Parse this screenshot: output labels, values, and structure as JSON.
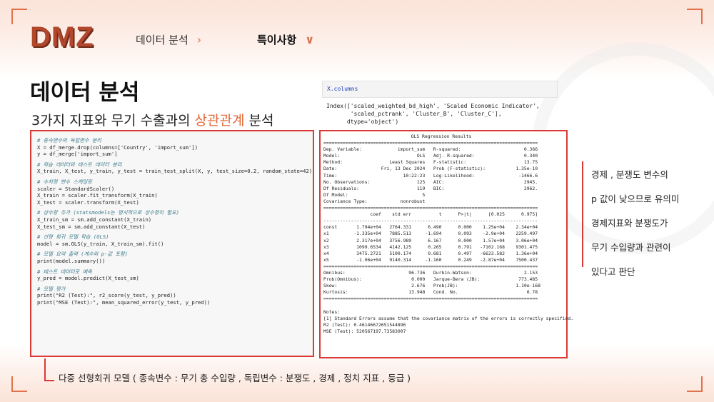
{
  "logo": "DMZ",
  "nav": {
    "item1": "데이터 분석",
    "item1_chevron": "›",
    "item2": "특이사항",
    "item2_chevron": "∨"
  },
  "page_title": "데이터 분석",
  "subtitle": {
    "prefix": "3가지 지표와 무기 수출과의 ",
    "accent": "상관관계",
    "suffix": " 분석"
  },
  "code": [
    {
      "t": "cm",
      "s": "# 종속변수와 독립변수 분리"
    },
    {
      "t": "code",
      "s": "X = df_merge.drop(columns=['Country', 'import_sum'])"
    },
    {
      "t": "code",
      "s": "y = df_merge['import_sum']"
    },
    {
      "t": "gap",
      "s": ""
    },
    {
      "t": "cm",
      "s": "# 학습 데이터와 테스트 데이터 분리"
    },
    {
      "t": "code",
      "s": "X_train, X_test, y_train, y_test = train_test_split(X, y, test_size=0.2, random_state=42)"
    },
    {
      "t": "gap",
      "s": ""
    },
    {
      "t": "cm",
      "s": "# 수치형 변수 스케일링"
    },
    {
      "t": "code",
      "s": "scaler = StandardScaler()"
    },
    {
      "t": "code",
      "s": "X_train = scaler.fit_transform(X_train)"
    },
    {
      "t": "code",
      "s": "X_test = scaler.transform(X_test)"
    },
    {
      "t": "gap",
      "s": ""
    },
    {
      "t": "cm",
      "s": "# 상수항 추가 (statsmodels는 명시적으로 상수항이 필요)"
    },
    {
      "t": "code",
      "s": "X_train_sm = sm.add_constant(X_train)"
    },
    {
      "t": "code",
      "s": "X_test_sm = sm.add_constant(X_test)"
    },
    {
      "t": "gap",
      "s": ""
    },
    {
      "t": "cm",
      "s": "# 선형 회귀 모델 학습 (OLS)"
    },
    {
      "t": "code",
      "s": "model = sm.OLS(y_train, X_train_sm).fit()"
    },
    {
      "t": "gap",
      "s": ""
    },
    {
      "t": "cm",
      "s": "# 모델 요약 출력 (계수와 p-값 포함)"
    },
    {
      "t": "code",
      "s": "print(model.summary())"
    },
    {
      "t": "gap",
      "s": ""
    },
    {
      "t": "cm",
      "s": "# 테스트 데이터로 예측"
    },
    {
      "t": "code",
      "s": "y_pred = model.predict(X_test_sm)"
    },
    {
      "t": "gap",
      "s": ""
    },
    {
      "t": "cm",
      "s": "# 모델 평가"
    },
    {
      "t": "code",
      "s": "print(\"R2 (Test):\", r2_score(y_test, y_pred))"
    },
    {
      "t": "code",
      "s": "print(\"MSE (Test):\", mean_squared_error(y_test, y_pred))"
    }
  ],
  "xcolumns_cell": "X.columns",
  "index_output": [
    "Index(['scaled_weighted_bd_high', 'Scaled Economic Indicator',",
    "       'scaled_pctrank', 'Cluster_B', 'Cluster_C'],",
    "      dtype='object')"
  ],
  "ols": {
    "title": "OLS Regression Results",
    "lines": [
      "==============================================================================",
      "Dep. Variable:             import_sum   R-squared:                       0.366",
      "Model:                            OLS   Adj. R-squared:                  0.340",
      "Method:                 Least Squares   F-statistic:                     13.75",
      "Date:                Fri, 13 Dec 2024   Prob (F-statistic):           1.35e-10",
      "Time:                        10:22:23   Log-Likelihood:                -1466.6",
      "No. Observations:                 125   AIC:                             2945.",
      "Df Residuals:                     119   BIC:                             2962.",
      "Df Model:                           5",
      "Covariance Type:            nonrobust",
      "==============================================================================",
      "                 coef    std err          t      P>|t|      [0.025      0.975]",
      "------------------------------------------------------------------------------",
      "const       1.794e+04   2764.331      6.490      0.000    1.25e+04    2.34e+04",
      "x1         -1.335e+04   7885.513     -1.694      0.093    -2.9e+04    2259.497",
      "x2          2.317e+04   3756.989      6.167      0.000    1.57e+04    3.06e+04",
      "x3          1099.6534   4142.125      0.265      0.791   -7102.168    9301.475",
      "x4          3475.2721   5100.174      0.681      0.497   -6623.582    1.36e+04",
      "x5          -1.06e+04   9140.314     -1.160      0.249   -2.87e+04    7500.437",
      "==============================================================================",
      "Omnibus:                       96.736   Durbin-Watson:                   2.153",
      "Prob(Omnibus):                  0.000   Jarque-Bera (JB):              773.485",
      "Skew:                           2.676   Prob(JB):                     1.10e-168",
      "Kurtosis:                      13.948   Cond. No.                         6.78",
      "==============================================================================",
      "",
      "Notes:",
      "[1] Standard Errors assume that the covariance matrix of the errors is correctly specified.",
      "R2 (Test): 0.46146672651544896",
      "MSE (Test): 520567197.73583007"
    ]
  },
  "remark": [
    "경제 , 분쟁도 변수의",
    "p 값이 낮으므로 유의미",
    "경제지표와 분쟁도가",
    "무기 수입량과 관련이",
    "있다고 판단"
  ],
  "caption": "다중 선형회귀 모델 ( 종속변수 : 무기 총 수입량 , 독립변수 : 분쟁도 , 경제 , 정치 지표 , 등급 )",
  "colors": {
    "accent": "#e2693a",
    "frame_red": "#d93a35",
    "logo": "#b2472c"
  }
}
